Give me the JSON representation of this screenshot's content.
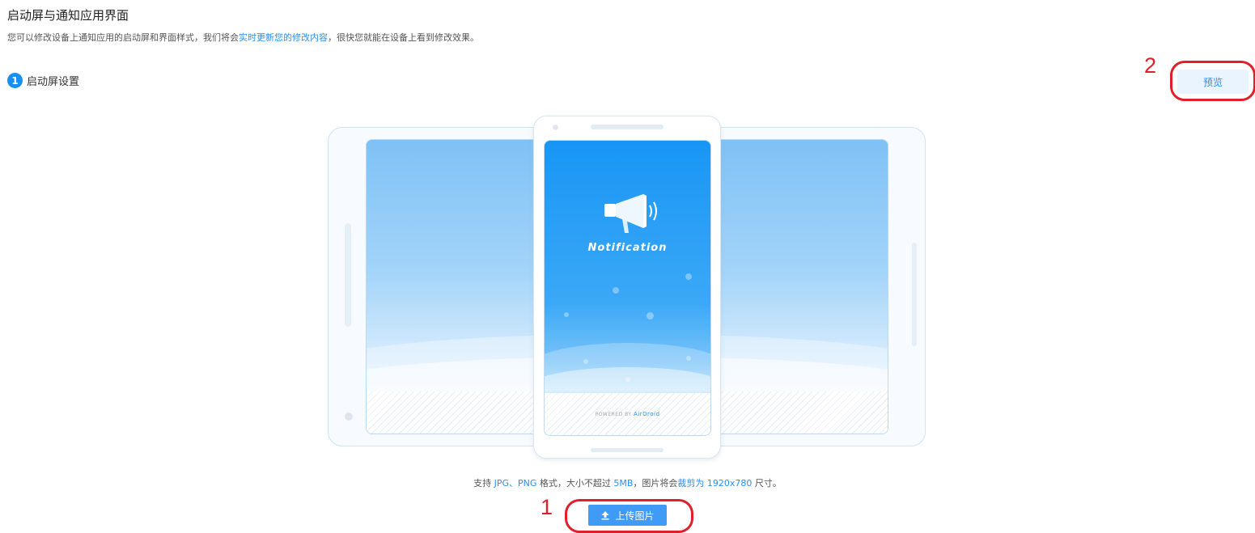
{
  "header": {
    "title": "启动屏与通知应用界面",
    "desc_prefix": "您可以修改设备上通知应用的启动屏和界面样式，我们将会",
    "desc_link": "实时更新您的修改内容",
    "desc_suffix": "，很快您就能在设备上看到修改效果。"
  },
  "step": {
    "number": "1",
    "label": "启动屏设置"
  },
  "preview_button": "预览",
  "phone_preview": {
    "app_title": "Notification",
    "powered_by": "POWERED BY",
    "brand": "AirDroid"
  },
  "hint": {
    "t1": "支持 ",
    "formats": "JPG、PNG",
    "t2": " 格式，大小不超过 ",
    "max_size": "5MB",
    "t3": "，图片将会",
    "crop": "裁剪为 1920x780",
    "t4": " 尺寸。"
  },
  "upload_button": "上传图片",
  "annotations": {
    "upload_marker": "1",
    "preview_marker": "2"
  },
  "colors": {
    "accent": "#2b8ef0",
    "annotation": "#e01f2a"
  }
}
